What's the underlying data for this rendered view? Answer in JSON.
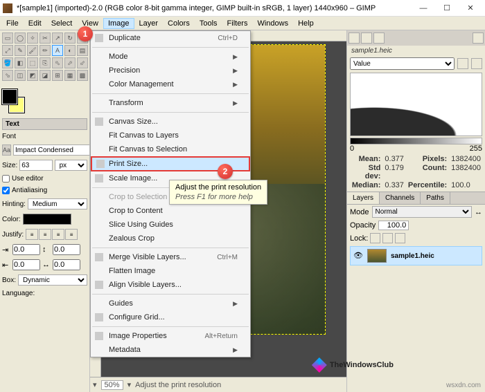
{
  "titlebar": {
    "title": "*[sample1] (imported)-2.0 (RGB color 8-bit gamma integer, GIMP built-in sRGB, 1 layer) 1440x960 – GIMP"
  },
  "menubar": [
    "File",
    "Edit",
    "Select",
    "View",
    "Image",
    "Layer",
    "Colors",
    "Tools",
    "Filters",
    "Windows",
    "Help"
  ],
  "menu_active_index": 4,
  "dropdown": {
    "items": [
      {
        "label": "Duplicate",
        "shortcut": "Ctrl+D",
        "icon": true
      },
      {
        "sep": true
      },
      {
        "label": "Mode",
        "submenu": true
      },
      {
        "label": "Precision",
        "submenu": true
      },
      {
        "label": "Color Management",
        "submenu": true
      },
      {
        "sep": true
      },
      {
        "label": "Transform",
        "submenu": true
      },
      {
        "sep": true
      },
      {
        "label": "Canvas Size...",
        "icon": true
      },
      {
        "label": "Fit Canvas to Layers"
      },
      {
        "label": "Fit Canvas to Selection"
      },
      {
        "label": "Print Size...",
        "icon": true,
        "highlight": true
      },
      {
        "label": "Scale Image...",
        "icon": true
      },
      {
        "sep": true
      },
      {
        "label": "Crop to Selection",
        "disabled": true
      },
      {
        "label": "Crop to Content"
      },
      {
        "label": "Slice Using Guides"
      },
      {
        "label": "Zealous Crop"
      },
      {
        "sep": true
      },
      {
        "label": "Merge Visible Layers...",
        "shortcut": "Ctrl+M",
        "icon": true
      },
      {
        "label": "Flatten Image"
      },
      {
        "label": "Align Visible Layers...",
        "icon": true
      },
      {
        "sep": true
      },
      {
        "label": "Guides",
        "submenu": true
      },
      {
        "label": "Configure Grid...",
        "icon": true
      },
      {
        "sep": true
      },
      {
        "label": "Image Properties",
        "shortcut": "Alt+Return",
        "icon": true
      },
      {
        "label": "Metadata",
        "submenu": true
      }
    ]
  },
  "tooltip": {
    "title": "Adjust the print resolution",
    "sub": "Press F1 for more help"
  },
  "callouts": {
    "1": "1",
    "2": "2"
  },
  "toolopts": {
    "section": "Text",
    "font_label": "Font",
    "font_value": "Impact Condensed",
    "size_label": "Size:",
    "size_value": "63",
    "unit": "px",
    "use_editor": "Use editor",
    "antialias": "Antialiasing",
    "hinting_label": "Hinting:",
    "hinting_value": "Medium",
    "color_label": "Color:",
    "justify_label": "Justify:",
    "indent1": "0.0",
    "indent2": "0.0",
    "indent3": "0.0",
    "indent4": "0.0",
    "box_label": "Box:",
    "box_value": "Dynamic",
    "lang_label": "Language:"
  },
  "status": {
    "zoom": "50%",
    "text": "Adjust the print resolution"
  },
  "right": {
    "docname": "sample1.heic",
    "channel": "Value",
    "range_min": "0",
    "range_max": "255",
    "stats": {
      "mean_l": "Mean:",
      "mean_v": "0.377",
      "pixels_l": "Pixels:",
      "pixels_v": "1382400",
      "std_l": "Std dev:",
      "std_v": "0.179",
      "count_l": "Count:",
      "count_v": "1382400",
      "median_l": "Median:",
      "median_v": "0.337",
      "perc_l": "Percentile:",
      "perc_v": "100.0"
    },
    "tabs2": [
      "Layers",
      "Channels",
      "Paths"
    ],
    "mode_label": "Mode",
    "mode_value": "Normal",
    "opacity_label": "Opacity",
    "opacity_value": "100.0",
    "lock_label": "Lock:",
    "layer_name": "sample1.heic"
  },
  "watermark": {
    "text": "TheWindowsClub",
    "site": "wsxdn.com"
  }
}
